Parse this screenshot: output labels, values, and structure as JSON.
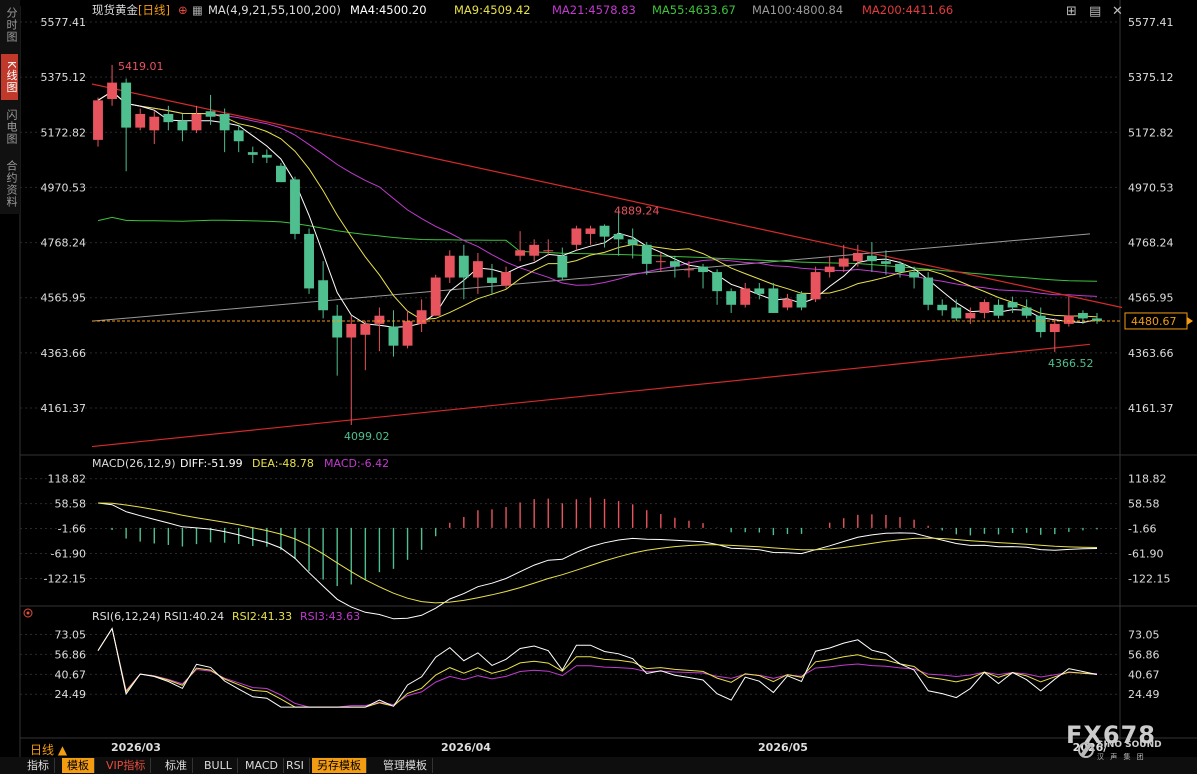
{
  "header": {
    "symbol": "现货黄金",
    "period": "[日线]",
    "ma_params": "MA(4,9,21,55,100,200)",
    "ma4": "MA4:4500.20",
    "ma9": "MA9:4509.42",
    "ma21": "MA21:4578.83",
    "ma55": "MA55:4633.67",
    "ma100": "MA100:4800.84",
    "ma200": "MA200:4411.66"
  },
  "macd_header": {
    "title": "MACD(26,12,9)",
    "diff": "DIFF:-51.99",
    "dea": "DEA:-48.78",
    "macd": "MACD:-6.42"
  },
  "rsi_header": {
    "title": "RSI(6,12,24)",
    "rsi1": "RSI1:40.24",
    "rsi2": "RSI2:41.33",
    "rsi3": "RSI3:43.63"
  },
  "side_tabs": [
    "分时图",
    "K线图",
    "闪电图",
    "合约资料"
  ],
  "bottom_tabs": [
    "指标",
    "模板",
    "VIP指标",
    "标准",
    "BULL",
    "MACD",
    "RSI",
    "另存模板",
    "管理模板"
  ],
  "period_label": "日线 ▲",
  "watermark": {
    "brand": "FX678",
    "sub": "SINO SOUND",
    "sub_cn": "汉 声 集 团"
  },
  "colors": {
    "up": "#e8545e",
    "down": "#4fbf8f",
    "ma4": "#ffffff",
    "ma9": "#e8e04a",
    "ma21": "#c23ad0",
    "ma55": "#3cc33c",
    "ma100": "#9a9a9a",
    "ma200": "#e23b3b",
    "grid": "#2a2a2a"
  },
  "chart_data": [
    {
      "type": "candlestick",
      "name": "现货黄金",
      "yticks": [
        "5577.41",
        "5375.12",
        "5172.82",
        "4970.53",
        "4768.24",
        "4565.95",
        "4363.66",
        "4161.37"
      ],
      "ylim": [
        4099,
        5577.41
      ],
      "xticks": [
        "2026/03",
        "2026/04",
        "2026/05",
        "2026/"
      ],
      "current_price": "4480.67",
      "annotations": [
        "5419.01",
        "4889.24",
        "4099.02",
        "4366.52"
      ],
      "candles": [
        [
          5145,
          5290,
          5120,
          5300
        ],
        [
          5295,
          5355,
          5270,
          5420
        ],
        [
          5355,
          5190,
          5030,
          5370
        ],
        [
          5190,
          5240,
          5180,
          5260
        ],
        [
          5180,
          5230,
          5130,
          5250
        ],
        [
          5240,
          5210,
          5180,
          5270
        ],
        [
          5215,
          5180,
          5140,
          5240
        ],
        [
          5180,
          5240,
          5170,
          5270
        ],
        [
          5250,
          5230,
          5200,
          5310
        ],
        [
          5240,
          5180,
          5100,
          5260
        ],
        [
          5180,
          5140,
          5100,
          5200
        ],
        [
          5100,
          5090,
          5060,
          5120
        ],
        [
          5090,
          5080,
          5060,
          5110
        ],
        [
          5050,
          4990,
          4990,
          5060
        ],
        [
          5000,
          4800,
          4780,
          5010
        ],
        [
          4800,
          4600,
          4580,
          4820
        ],
        [
          4630,
          4520,
          4490,
          4700
        ],
        [
          4500,
          4420,
          4280,
          4540
        ],
        [
          4420,
          4470,
          4099,
          4500
        ],
        [
          4430,
          4470,
          4300,
          4480
        ],
        [
          4470,
          4500,
          4370,
          4530
        ],
        [
          4460,
          4390,
          4350,
          4520
        ],
        [
          4390,
          4480,
          4380,
          4520
        ],
        [
          4470,
          4520,
          4440,
          4560
        ],
        [
          4500,
          4640,
          4500,
          4650
        ],
        [
          4640,
          4720,
          4620,
          4740
        ],
        [
          4720,
          4640,
          4560,
          4760
        ],
        [
          4640,
          4700,
          4580,
          4730
        ],
        [
          4640,
          4620,
          4580,
          4690
        ],
        [
          4610,
          4660,
          4600,
          4680
        ],
        [
          4720,
          4740,
          4700,
          4810
        ],
        [
          4720,
          4760,
          4700,
          4780
        ],
        [
          4740,
          4740,
          4720,
          4780
        ],
        [
          4720,
          4640,
          4630,
          4750
        ],
        [
          4760,
          4820,
          4740,
          4830
        ],
        [
          4800,
          4820,
          4760,
          4830
        ],
        [
          4830,
          4790,
          4750,
          4835
        ],
        [
          4800,
          4780,
          4720,
          4889.24
        ],
        [
          4780,
          4760,
          4710,
          4820
        ],
        [
          4760,
          4690,
          4650,
          4770
        ],
        [
          4700,
          4700,
          4660,
          4730
        ],
        [
          4700,
          4680,
          4640,
          4720
        ],
        [
          4670,
          4670,
          4640,
          4700
        ],
        [
          4680,
          4660,
          4600,
          4690
        ],
        [
          4660,
          4590,
          4540,
          4670
        ],
        [
          4590,
          4540,
          4510,
          4600
        ],
        [
          4540,
          4600,
          4530,
          4620
        ],
        [
          4600,
          4580,
          4560,
          4620
        ],
        [
          4600,
          4510,
          4510,
          4620
        ],
        [
          4530,
          4560,
          4520,
          4580
        ],
        [
          4580,
          4530,
          4520,
          4590
        ],
        [
          4560,
          4660,
          4550,
          4680
        ],
        [
          4660,
          4680,
          4640,
          4720
        ],
        [
          4680,
          4710,
          4660,
          4760
        ],
        [
          4700,
          4730,
          4680,
          4760
        ],
        [
          4720,
          4700,
          4660,
          4770
        ],
        [
          4700,
          4690,
          4650,
          4740
        ],
        [
          4690,
          4660,
          4640,
          4700
        ],
        [
          4660,
          4640,
          4600,
          4680
        ],
        [
          4640,
          4540,
          4520,
          4660
        ],
        [
          4540,
          4520,
          4500,
          4560
        ],
        [
          4530,
          4490,
          4480,
          4560
        ],
        [
          4490,
          4510,
          4470,
          4530
        ],
        [
          4510,
          4550,
          4490,
          4560
        ],
        [
          4540,
          4500,
          4490,
          4560
        ],
        [
          4550,
          4530,
          4510,
          4570
        ],
        [
          4530,
          4500,
          4490,
          4560
        ],
        [
          4500,
          4440,
          4420,
          4530
        ],
        [
          4440,
          4470,
          4366.52,
          4490
        ],
        [
          4470,
          4500,
          4460,
          4570
        ],
        [
          4510,
          4490,
          4470,
          4520
        ],
        [
          4490,
          4480,
          4470,
          4510
        ]
      ]
    },
    {
      "type": "macd",
      "yticks": [
        "118.82",
        "58.58",
        "-1.66",
        "-61.90",
        "-122.15"
      ],
      "ylim": [
        -150,
        130
      ]
    },
    {
      "type": "rsi",
      "yticks": [
        "73.05",
        "56.86",
        "40.67",
        "24.49"
      ],
      "ylim": [
        10,
        80
      ]
    }
  ]
}
